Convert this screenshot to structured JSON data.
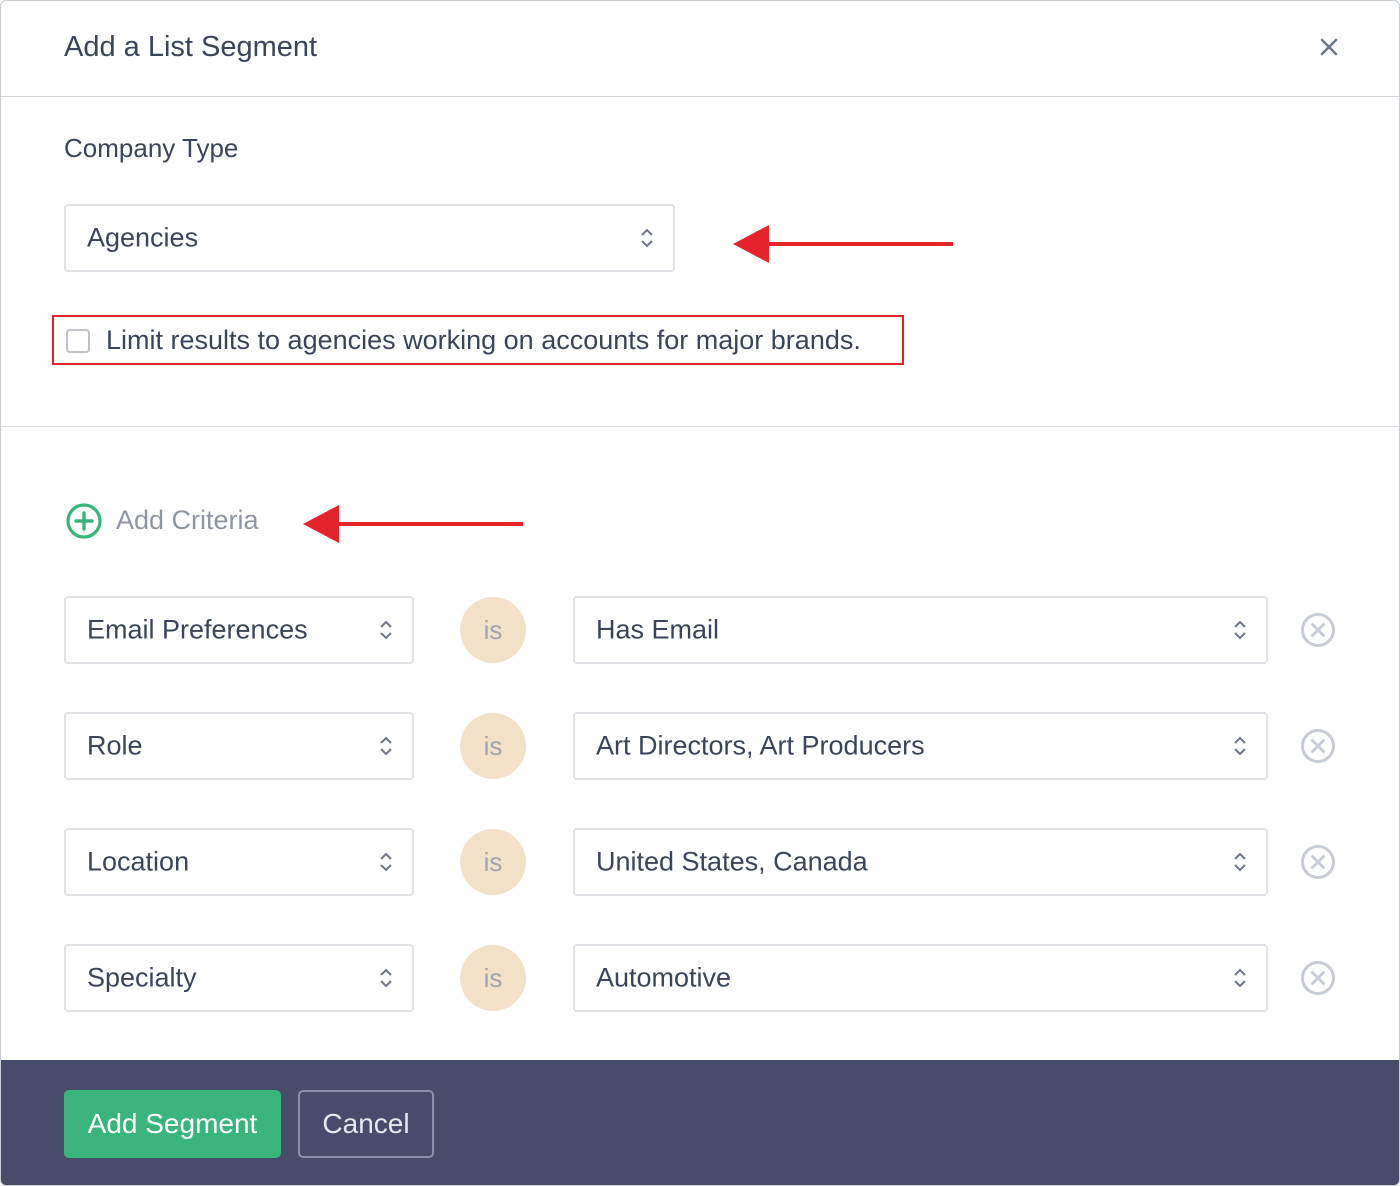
{
  "modal": {
    "title": "Add a List Segment",
    "close_icon": "close-icon"
  },
  "company_type": {
    "label": "Company Type",
    "selected": "Agencies"
  },
  "limit_checkbox": {
    "label": "Limit results to agencies working on accounts for major brands.",
    "checked": false
  },
  "add_criteria": {
    "label": "Add Criteria",
    "icon": "plus-circle-icon",
    "icon_color": "#39b57b"
  },
  "criteria": [
    {
      "field": "Email Preferences",
      "operator": "is",
      "value": "Has Email"
    },
    {
      "field": "Role",
      "operator": "is",
      "value": "Art Directors, Art Producers"
    },
    {
      "field": "Location",
      "operator": "is",
      "value": "United States, Canada"
    },
    {
      "field": "Specialty",
      "operator": "is",
      "value": "Automotive"
    }
  ],
  "footer": {
    "primary_label": "Add Segment",
    "cancel_label": "Cancel"
  },
  "colors": {
    "accent": "#39b57b",
    "footer_bg": "#484c6b",
    "annotation": "#e4232b",
    "operator_badge": "#f3e2c9"
  }
}
